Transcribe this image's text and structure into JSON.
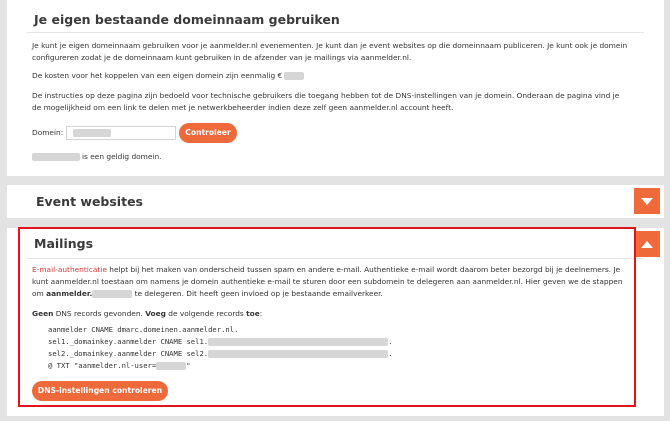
{
  "custom_domain": {
    "title": "Je eigen bestaande domeinnaam gebruiken",
    "intro_line1": "Je kunt je eigen domeinnaam gebruiken voor je aanmelder.nl evenementen. Je kunt dan je event websites op die domeinnaam publiceren. Je kunt ook je domein",
    "intro_line2": "configureren zodat je de domeinnaam kunt gebruiken in de afzender van je mailings via aanmelder.nl.",
    "cost_text": "De kosten voor het koppelen van een eigen domein zijn eenmalig €",
    "instructions_line1": "De instructies op deze pagina zijn bedoeld voor technische gebruikers die toegang hebben tot de DNS-instellingen van je domein. Onderaan de pagina vind je",
    "instructions_line2": "de mogelijkheid om een link te delen met je netwerkbeheerder indien deze zelf geen aanmelder.nl account heeft.",
    "domain_label": "Domein:",
    "check_button": "Controleer",
    "valid_suffix": "is een geldig domein."
  },
  "event_websites": {
    "title": "Event websites",
    "toggle_icon": "chevron-down-icon"
  },
  "mailings": {
    "title": "Mailings",
    "toggle_icon": "chevron-up-icon",
    "link_text": "E-mail-authenticatie",
    "desc_line1_rest": " helpt bij het maken van onderscheid tussen spam en andere e-mail. Authentieke e-mail wordt daarom beter bezorgd bij je deelnemers. Je",
    "desc_line2": "kunt aanmelder.nl toestaan om namens je domein authentieke e-mail te sturen door een subdomein te delegeren aan aanmelder.nl. Hier geven we de stappen",
    "desc_line3_pre": "om ",
    "desc_line3_bold": "aanmelder.",
    "desc_line3_post": " te delegeren. Dit heeft geen invloed op je bestaande emailverkeer.",
    "status_bold": "Geen",
    "status_mid": " DNS records gevonden. ",
    "status_bold2": "Voeg",
    "status_mid2": " de volgende records ",
    "status_bold3": "toe",
    "status_end": ":",
    "records": [
      "aanmelder CNAME dmarc.domeinen.aanmelder.nl.",
      "sel1._domainkey.aanmelder CNAME sel1.",
      "sel2._domainkey.aanmelder CNAME sel2.",
      "@ TXT \"aanmelder.nl-user="
    ],
    "record_line_end": ".",
    "txt_quote_end": "\"",
    "dns_button": "DNS-instellingen controleren"
  },
  "colors": {
    "accent": "#ee6a3b",
    "highlight_border": "#e0141b",
    "link": "#d83a3a",
    "background": "#e3e3e3"
  }
}
